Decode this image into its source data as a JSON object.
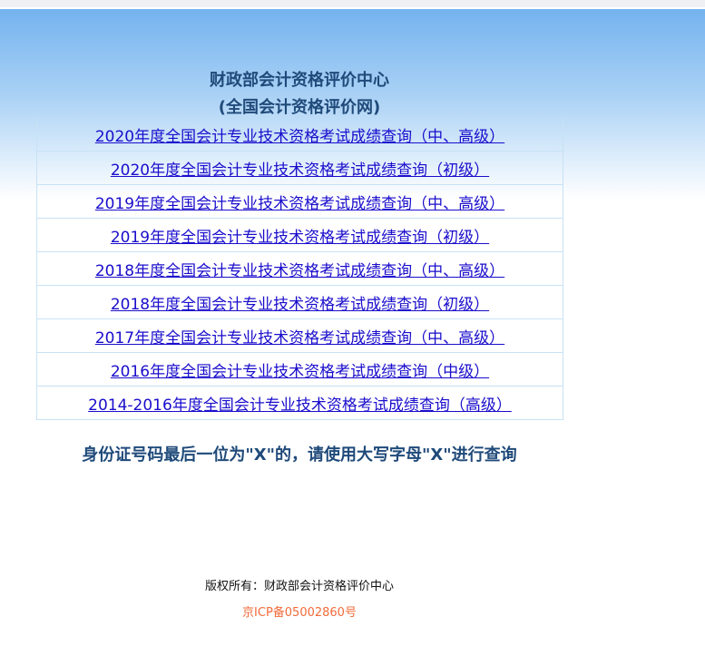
{
  "header": {
    "title": "财政部会计资格评价中心",
    "subtitle": "(全国会计资格评价网)"
  },
  "links": [
    "2020年度全国会计专业技术资格考试成绩查询（中、高级）",
    "2020年度全国会计专业技术资格考试成绩查询（初级）",
    "2019年度全国会计专业技术资格考试成绩查询（中、高级）",
    "2019年度全国会计专业技术资格考试成绩查询（初级）",
    "2018年度全国会计专业技术资格考试成绩查询（中、高级）",
    "2018年度全国会计专业技术资格考试成绩查询（初级）",
    "2017年度全国会计专业技术资格考试成绩查询（中、高级）",
    "2016年度全国会计专业技术资格考试成绩查询（中级）",
    "2014-2016年度全国会计专业技术资格考试成绩查询（高级）"
  ],
  "notice": "身份证号码最后一位为\"X\"的，请使用大写字母\"X\"进行查询",
  "footer": {
    "copyright": "版权所有：财政部会计资格评价中心",
    "icp": "京ICP备05002860号"
  }
}
